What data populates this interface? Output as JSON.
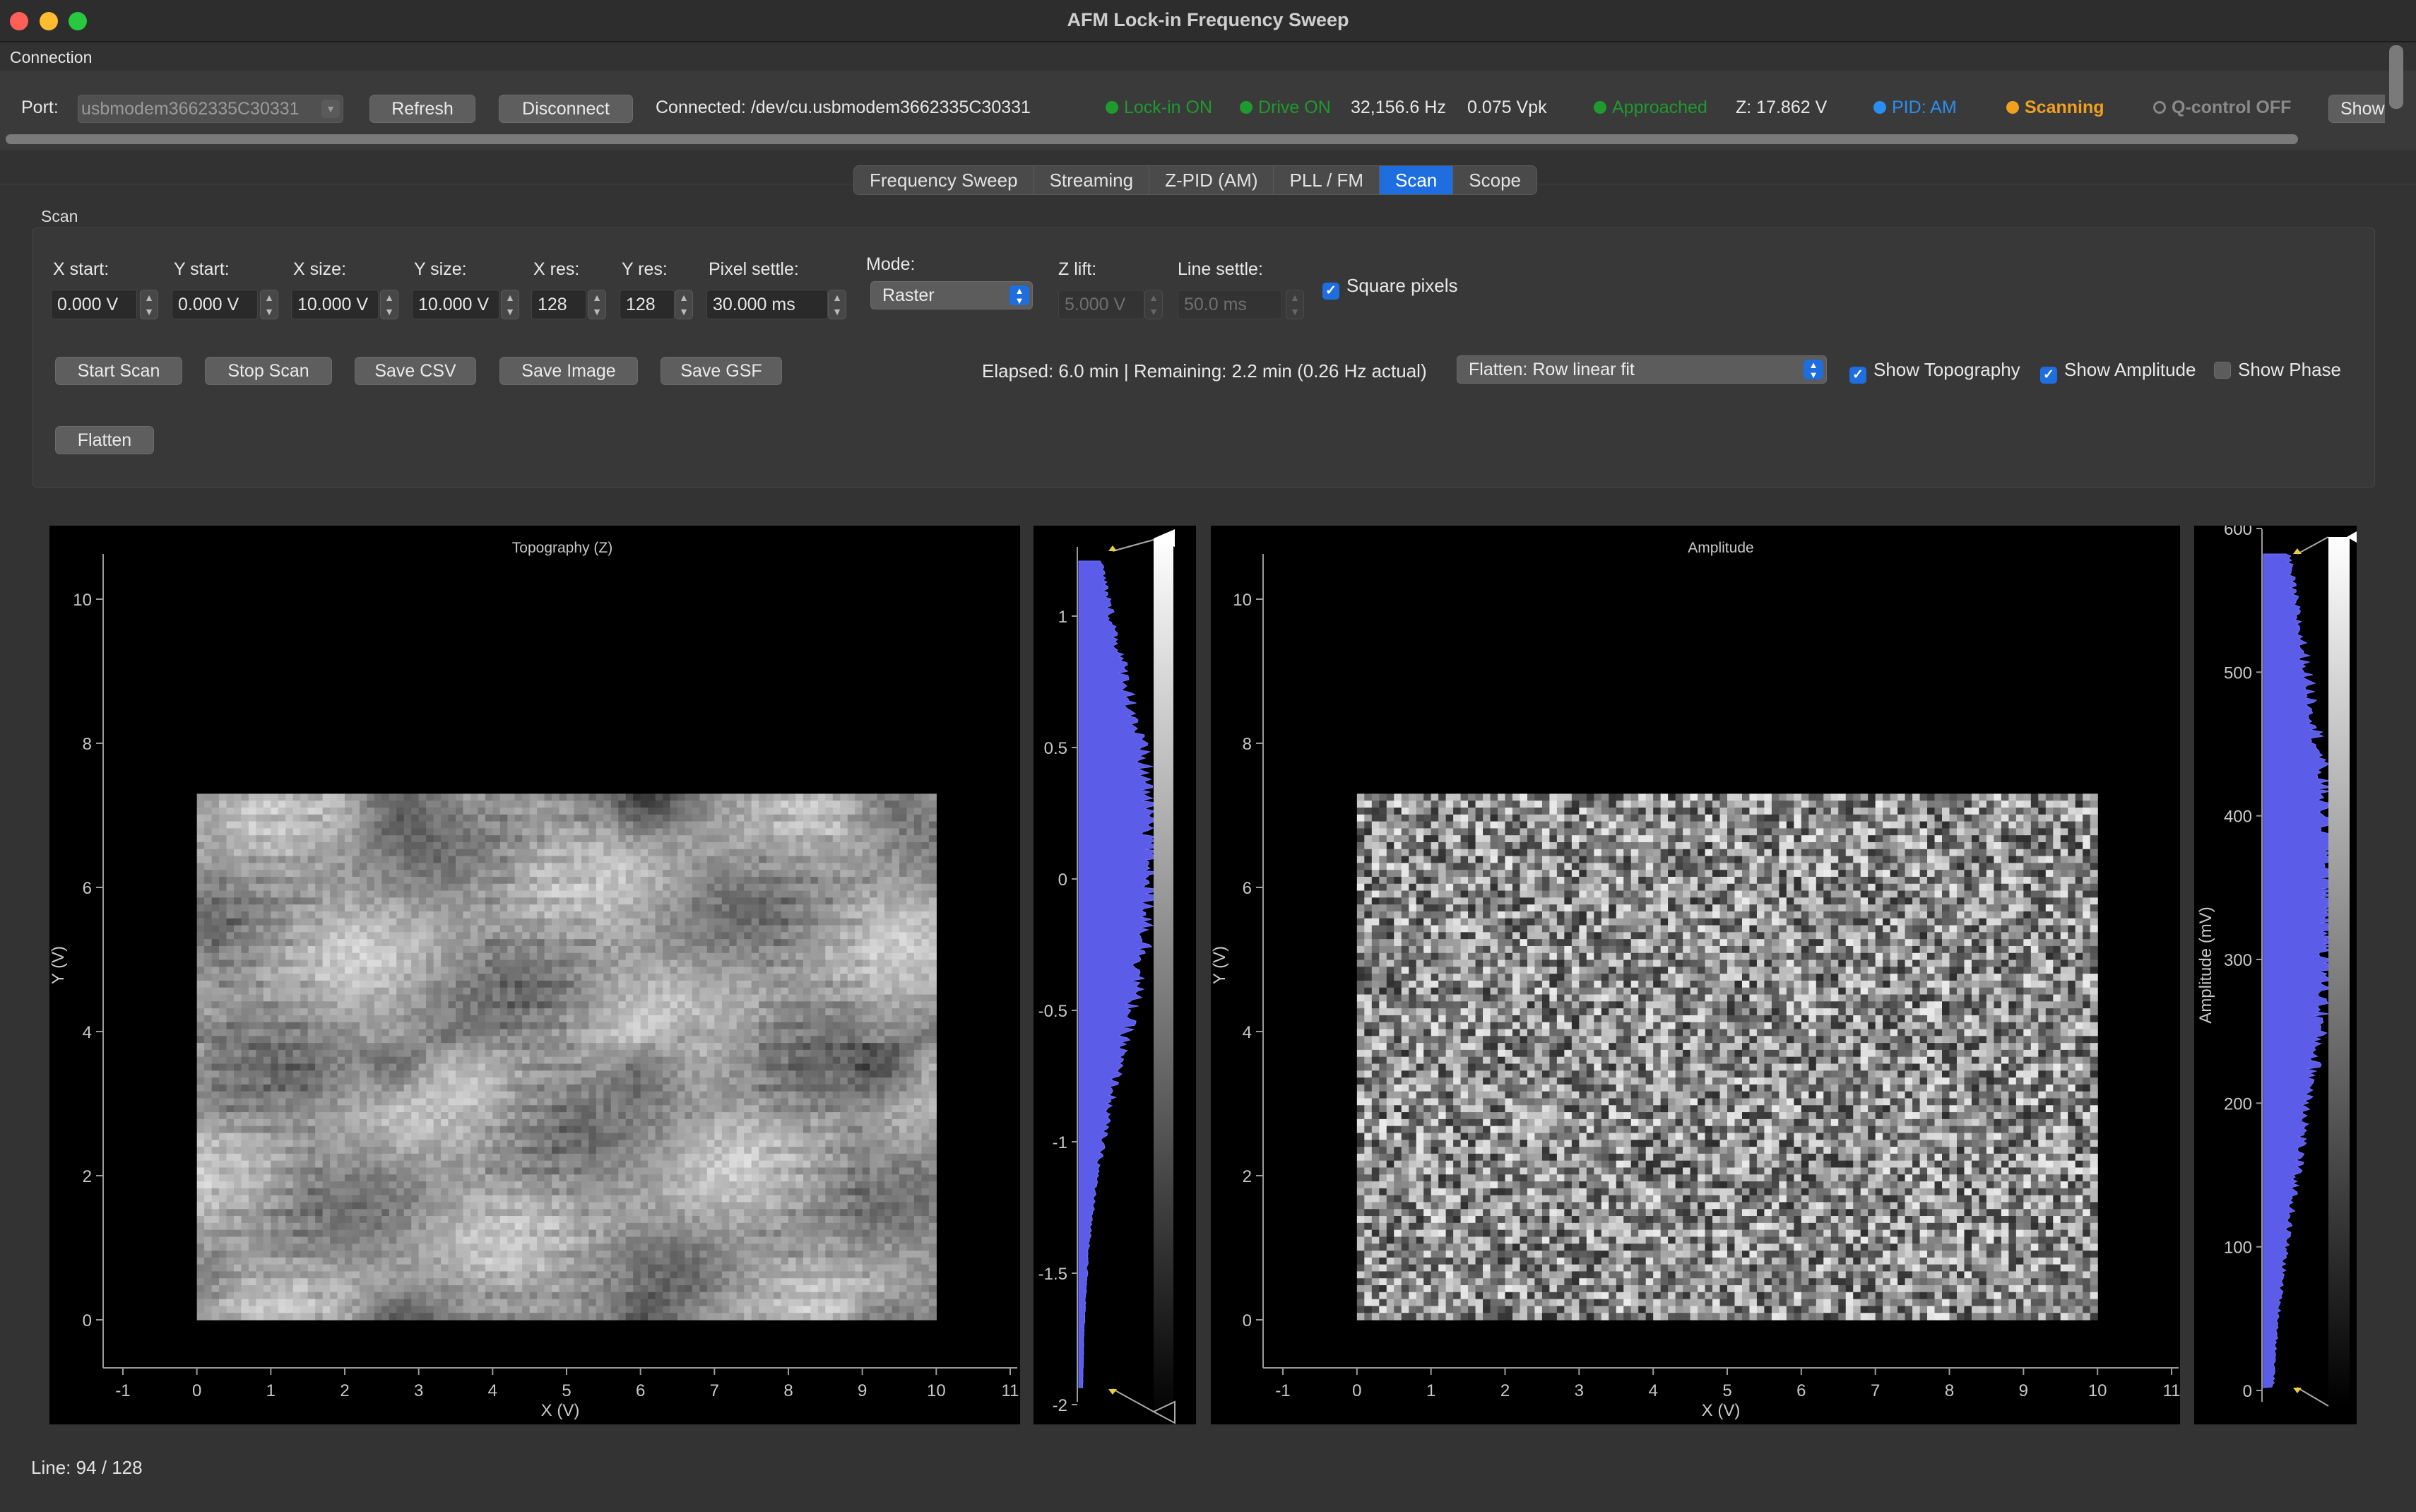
{
  "window": {
    "title": "AFM Lock-in Frequency Sweep"
  },
  "connection": {
    "group_label": "Connection",
    "port_label": "Port:",
    "port_value": "usbmodem3662335C30331",
    "refresh_label": "Refresh",
    "disconnect_label": "Disconnect",
    "connected_text": "Connected: /dev/cu.usbmodem3662335C30331",
    "lockin": "Lock-in ON",
    "drive": "Drive ON",
    "frequency": "32,156.6 Hz",
    "drive_amplitude": "0.075 Vpk",
    "approached": "Approached",
    "z_voltage": "Z: 17.862 V",
    "pid": "PID: AM",
    "scanning": "Scanning",
    "qcontrol": "Q-control OFF",
    "show_label": "Show"
  },
  "tabs": [
    {
      "label": "Frequency Sweep"
    },
    {
      "label": "Streaming"
    },
    {
      "label": "Z-PID (AM)"
    },
    {
      "label": "PLL / FM"
    },
    {
      "label": "Scan"
    },
    {
      "label": "Scope"
    }
  ],
  "scan": {
    "group_label": "Scan",
    "fields": {
      "x_start": {
        "label": "X start:",
        "value": "0.000 V"
      },
      "y_start": {
        "label": "Y start:",
        "value": "0.000 V"
      },
      "x_size": {
        "label": "X size:",
        "value": "10.000 V"
      },
      "y_size": {
        "label": "Y size:",
        "value": "10.000 V"
      },
      "x_res": {
        "label": "X res:",
        "value": "128"
      },
      "y_res": {
        "label": "Y res:",
        "value": "128"
      },
      "pixel_settle": {
        "label": "Pixel settle:",
        "value": "30.000 ms"
      },
      "mode": {
        "label": "Mode:",
        "value": "Raster"
      },
      "z_lift": {
        "label": "Z lift:",
        "value": "5.000 V"
      },
      "line_settle": {
        "label": "Line settle:",
        "value": "50.0 ms"
      }
    },
    "square_pixels": {
      "label": "Square pixels",
      "checked": true
    },
    "buttons": {
      "start": "Start Scan",
      "stop": "Stop Scan",
      "save_csv": "Save CSV",
      "save_image": "Save Image",
      "save_gsf": "Save GSF",
      "flatten": "Flatten"
    },
    "timing": "Elapsed: 6.0 min | Remaining: 2.2 min (0.26 Hz actual)",
    "flatten_mode": "Flatten: Row linear fit",
    "show_topography": {
      "label": "Show Topography",
      "checked": true
    },
    "show_amplitude": {
      "label": "Show Amplitude",
      "checked": true
    },
    "show_phase": {
      "label": "Show Phase",
      "checked": false
    }
  },
  "topography_plot": {
    "title": "Topography (Z)",
    "xlabel": "X (V)",
    "ylabel": "Y (V)",
    "x_ticks": [
      "-1",
      "0",
      "1",
      "2",
      "3",
      "4",
      "5",
      "6",
      "7",
      "8",
      "9",
      "10",
      "11"
    ],
    "y_ticks": [
      "0",
      "2",
      "4",
      "6",
      "8",
      "10"
    ],
    "colorbar_ticks": [
      "1",
      "0.5",
      "0",
      "-0.5",
      "-1",
      "-1.5",
      "-2"
    ]
  },
  "amplitude_plot": {
    "title": "Amplitude",
    "xlabel": "X (V)",
    "ylabel": "Y (V)",
    "x_ticks": [
      "-1",
      "0",
      "1",
      "2",
      "3",
      "4",
      "5",
      "6",
      "7",
      "8",
      "9",
      "10",
      "11"
    ],
    "y_ticks": [
      "0",
      "2",
      "4",
      "6",
      "8",
      "10"
    ],
    "colorbar_label": "Amplitude (mV)",
    "colorbar_ticks": [
      "600",
      "500",
      "400",
      "300",
      "200",
      "100",
      "0"
    ]
  },
  "status": {
    "line": "Line: 94 / 128"
  },
  "colors": {
    "accent": "#1f6ee0",
    "green": "#27a83a",
    "orange": "#f0a020",
    "histogram": "#5b5ce8"
  },
  "chart_data": [
    {
      "type": "heatmap",
      "title": "Topography (Z)",
      "xlabel": "X (V)",
      "ylabel": "Y (V)",
      "xlim": [
        -1,
        11
      ],
      "ylim": [
        0,
        10
      ],
      "data_extent": {
        "x": [
          0,
          10
        ],
        "y": [
          0,
          7.3
        ]
      },
      "grid": false,
      "colormap": "grayscale",
      "colorbar_range": [
        -2,
        1
      ]
    },
    {
      "type": "heatmap",
      "title": "Amplitude",
      "xlabel": "X (V)",
      "ylabel": "Y (V)",
      "xlim": [
        -1,
        11
      ],
      "ylim": [
        0,
        10
      ],
      "data_extent": {
        "x": [
          0,
          10
        ],
        "y": [
          0,
          7.3
        ]
      },
      "grid": false,
      "colormap": "grayscale",
      "colorbar_label": "Amplitude (mV)",
      "colorbar_range": [
        0,
        600
      ]
    }
  ]
}
